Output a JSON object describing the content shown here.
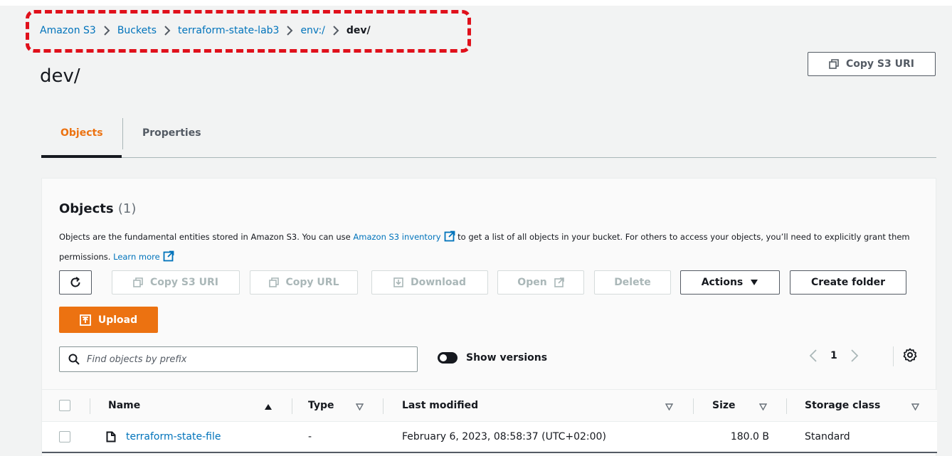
{
  "breadcrumb": {
    "items": [
      "Amazon S3",
      "Buckets",
      "terraform-state-lab3",
      "env:/"
    ],
    "current": "dev/"
  },
  "page": {
    "title": "dev/",
    "copy_s3_uri_label": "Copy S3 URI"
  },
  "tabs": {
    "objects": "Objects",
    "properties": "Properties",
    "active": "objects"
  },
  "objects_panel": {
    "title": "Objects",
    "count": "(1)",
    "desc_part1": "Objects are the fundamental entities stored in Amazon S3. You can use ",
    "desc_link1": "Amazon S3 inventory",
    "desc_part2": " to get a list of all objects in your bucket. For others to access your objects, you’ll need to explicitly grant them permissions. ",
    "desc_link2": "Learn more"
  },
  "toolbar": {
    "copy_s3_uri": "Copy S3 URI",
    "copy_url": "Copy URL",
    "download": "Download",
    "open": "Open",
    "delete": "Delete",
    "actions": "Actions",
    "create_folder": "Create folder",
    "upload": "Upload"
  },
  "search": {
    "placeholder": "Find objects by prefix"
  },
  "versions": {
    "label": "Show versions"
  },
  "pagination": {
    "current_page": "1"
  },
  "table": {
    "columns": {
      "name": "Name",
      "type": "Type",
      "last_modified": "Last modified",
      "size": "Size",
      "storage_class": "Storage class"
    },
    "rows": [
      {
        "name": "terraform-state-file",
        "type": "-",
        "last_modified": "February 6, 2023, 08:58:37 (UTC+02:00)",
        "size": "180.0 B",
        "storage_class": "Standard"
      }
    ]
  },
  "colors": {
    "link": "#0073bb",
    "accent": "#ec7211",
    "annotation": "#e0101b"
  }
}
